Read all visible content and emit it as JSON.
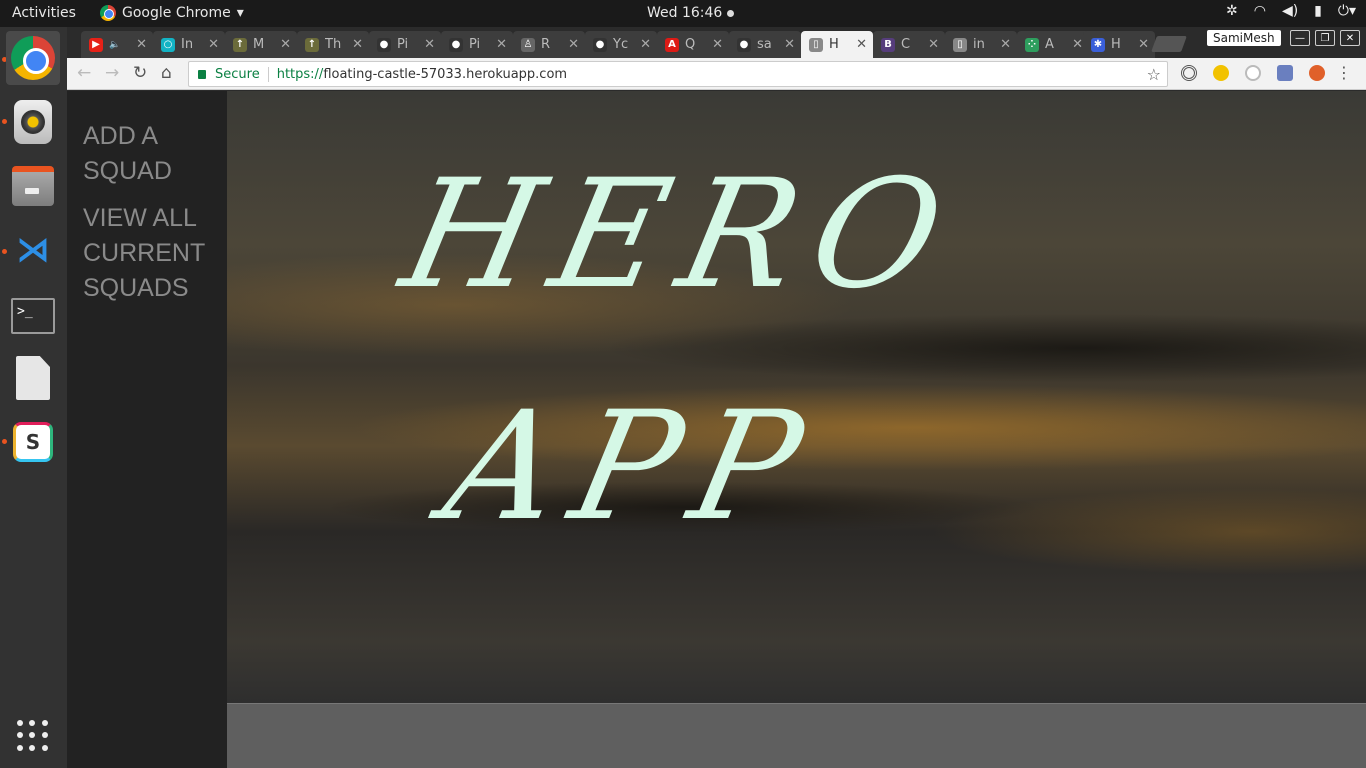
{
  "topbar": {
    "activities": "Activities",
    "app_name": "Google Chrome",
    "app_menu_arrow": "▾",
    "clock": "Wed 16:46",
    "tray_icons": [
      "settings-icon",
      "wifi-icon",
      "volume-icon",
      "battery-icon",
      "power-icon"
    ]
  },
  "dock": {
    "items": [
      "chrome-icon",
      "rhythmbox-icon",
      "files-icon",
      "vscode-icon",
      "terminal-icon",
      "document-icon",
      "slack-icon"
    ],
    "apps_grid": "show-applications-icon"
  },
  "browser": {
    "tabs": [
      {
        "title": "",
        "favicon_color": "#e62117",
        "favicon": "▶",
        "audio": true
      },
      {
        "title": "In",
        "favicon_color": "#13b3c4",
        "favicon": "○"
      },
      {
        "title": "M",
        "favicon_color": "#6b6b3a",
        "favicon": "↑"
      },
      {
        "title": "Th",
        "favicon_color": "#6b6b3a",
        "favicon": "↑"
      },
      {
        "title": "Pi",
        "favicon_color": "#333333",
        "favicon": "●"
      },
      {
        "title": "Pi",
        "favicon_color": "#333333",
        "favicon": "●"
      },
      {
        "title": "R",
        "favicon_color": "#666666",
        "favicon": "♙"
      },
      {
        "title": "Yc",
        "favicon_color": "#333333",
        "favicon": "●"
      },
      {
        "title": "Q",
        "favicon_color": "#dd1b16",
        "favicon": "A"
      },
      {
        "title": "sa",
        "favicon_color": "#333333",
        "favicon": "●"
      },
      {
        "title": "H",
        "favicon_color": "#888888",
        "favicon": "▯",
        "active": true
      },
      {
        "title": "C",
        "favicon_color": "#563d7c",
        "favicon": "B"
      },
      {
        "title": "in",
        "favicon_color": "#888888",
        "favicon": "▯"
      },
      {
        "title": "A",
        "favicon_color": "#2e9e5e",
        "favicon": "⁘"
      },
      {
        "title": "H",
        "favicon_color": "#3a5fd9",
        "favicon": "✱"
      }
    ],
    "tab_close": "✕",
    "profile": "SamiMesh",
    "window_buttons": {
      "minimize": "—",
      "maximize": "❐",
      "close": "✕"
    },
    "nav": {
      "back": "←",
      "forward": "→",
      "reload": "↻",
      "home": "⌂"
    },
    "security_label": "Secure",
    "url_scheme": "https://",
    "url_host": "floating-castle-57033.herokuapp.com",
    "bookmark_star": "☆",
    "menu": "⋮",
    "extension_colors": [
      "#555555",
      "#f2c200",
      "#d9d9d9",
      "#6a7fbf",
      "#e0602a"
    ]
  },
  "page": {
    "nav_links": [
      "ADD A SQUAD",
      "VIEW ALL CURRENT SQUADS"
    ],
    "hero_title": "HERO APP",
    "colors": {
      "hero_text": "#d5f8e6",
      "sidenav_bg": "#222222",
      "nav_text": "#8a8a8a"
    }
  }
}
